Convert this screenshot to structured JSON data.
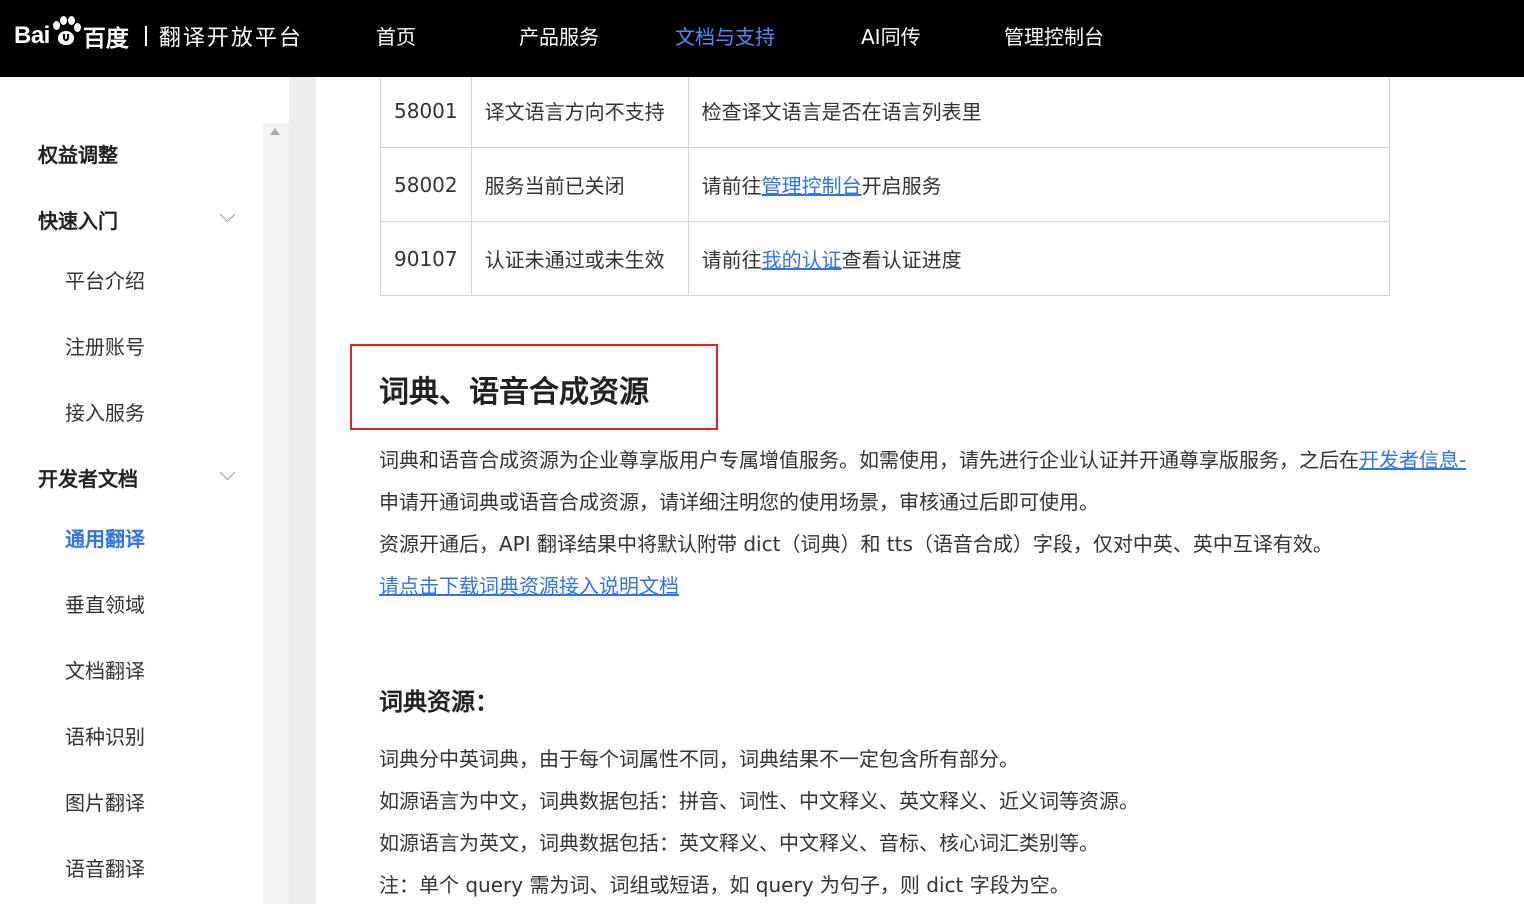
{
  "header": {
    "logo_bai": "Bai",
    "logo_cn": "百度",
    "platform_title": "翻译开放平台",
    "nav": [
      {
        "label": "首页",
        "active": false
      },
      {
        "label": "产品服务",
        "active": false
      },
      {
        "label": "文档与支持",
        "active": true
      },
      {
        "label": "AI同传",
        "active": false
      },
      {
        "label": "管理控制台",
        "active": false
      }
    ]
  },
  "sidebar": {
    "items": [
      {
        "label": "权益调整",
        "level": 1
      },
      {
        "label": "快速入门",
        "level": 1,
        "expandable": true
      },
      {
        "label": "平台介绍",
        "level": 2
      },
      {
        "label": "注册账号",
        "level": 2
      },
      {
        "label": "接入服务",
        "level": 2
      },
      {
        "label": "开发者文档",
        "level": 1,
        "expandable": true
      },
      {
        "label": "通用翻译",
        "level": 2,
        "active": true
      },
      {
        "label": "垂直领域",
        "level": 2
      },
      {
        "label": "文档翻译",
        "level": 2
      },
      {
        "label": "语种识别",
        "level": 2
      },
      {
        "label": "图片翻译",
        "level": 2
      },
      {
        "label": "语音翻译",
        "level": 2
      }
    ]
  },
  "error_table": {
    "rows": [
      {
        "code": "58001",
        "message": "译文语言方向不支持",
        "solution_before": "检查译文语言是否在语言列表里",
        "solution_link": "",
        "solution_after": ""
      },
      {
        "code": "58002",
        "message": "服务当前已关闭",
        "solution_before": "请前往",
        "solution_link": "管理控制台",
        "solution_after": "开启服务"
      },
      {
        "code": "90107",
        "message": "认证未通过或未生效",
        "solution_before": "请前往",
        "solution_link": "我的认证",
        "solution_after": "查看认证进度"
      }
    ]
  },
  "section": {
    "title": "词典、语音合成资源",
    "para1_text": "词典和语音合成资源为企业尊享版用户专属增值服务。如需使用，请先进行企业认证并开通尊享版服务，之后在",
    "para1_link": "开发者信息-",
    "para2": "申请开通词典或语音合成资源，请详细注明您的使用场景，审核通过后即可使用。",
    "para3": "资源开通后，API 翻译结果中将默认附带 dict（词典）和 tts（语音合成）字段，仅对中英、英中互译有效。",
    "download_link": "请点击下载词典资源接入说明文档"
  },
  "dict_section": {
    "title": "词典资源：",
    "lines": [
      "词典分中英词典，由于每个词属性不同，词典结果不一定包含所有部分。",
      "如源语言为中文，词典数据包括：拼音、词性、中文释义、英文释义、近义词等资源。",
      "如源语言为英文，词典数据包括：英文释义、中文释义、音标、核心词汇类别等。",
      "注：单个 query 需为词、词组或短语，如 query 为句子，则 dict 字段为空。"
    ]
  },
  "colors": {
    "topbar_bg": "#000000",
    "nav_active": "#4e8df5",
    "link": "#2f74e7",
    "highlight_box": "#e0222b"
  }
}
